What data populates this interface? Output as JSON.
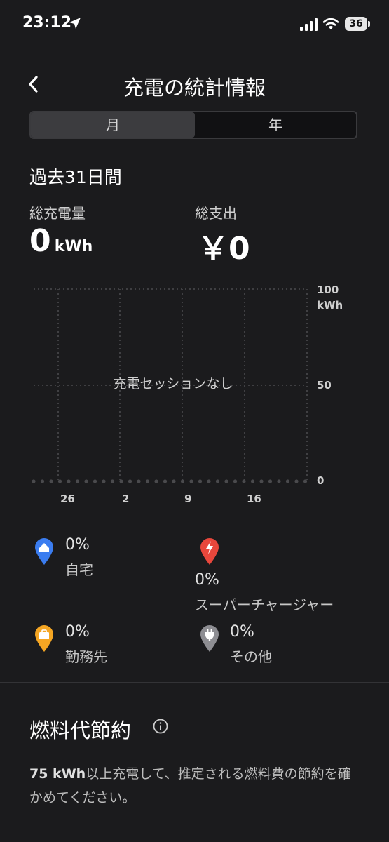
{
  "status": {
    "time": "23:12",
    "battery": "36"
  },
  "header": {
    "title": "充電の統計情報"
  },
  "tabs": [
    {
      "label": "月"
    },
    {
      "label": "年"
    }
  ],
  "period": "過去31日間",
  "totals": {
    "energy_label": "総充電量",
    "energy_value": "0",
    "energy_unit": "kWh",
    "cost_label": "総支出",
    "cost_value": "￥0"
  },
  "chart_data": {
    "type": "bar",
    "title": "",
    "empty_message": "充電セッションなし",
    "y_ticks": [
      "100",
      "50",
      "0"
    ],
    "y_unit": "kWh",
    "x_ticks": [
      "26",
      "2",
      "9",
      "16"
    ],
    "ylim": [
      0,
      100
    ],
    "values": [],
    "grid": true
  },
  "legend": [
    {
      "pct": "0%",
      "name": "自宅",
      "icon": "home-pin-icon",
      "color": "#3b7df0"
    },
    {
      "pct": "0%",
      "name": "スーパーチャージャー",
      "icon": "supercharger-pin-icon",
      "color": "#e8473c"
    },
    {
      "pct": "0%",
      "name": "勤務先",
      "icon": "work-pin-icon",
      "color": "#f5a623"
    },
    {
      "pct": "0%",
      "name": "その他",
      "icon": "other-pin-icon",
      "color": "#8e8e93"
    }
  ],
  "fuel": {
    "title": "燃料代節約",
    "desc_bold": "75 kWh",
    "desc_rest": "以上充電して、推定される燃料費の節約を確かめてください。"
  }
}
